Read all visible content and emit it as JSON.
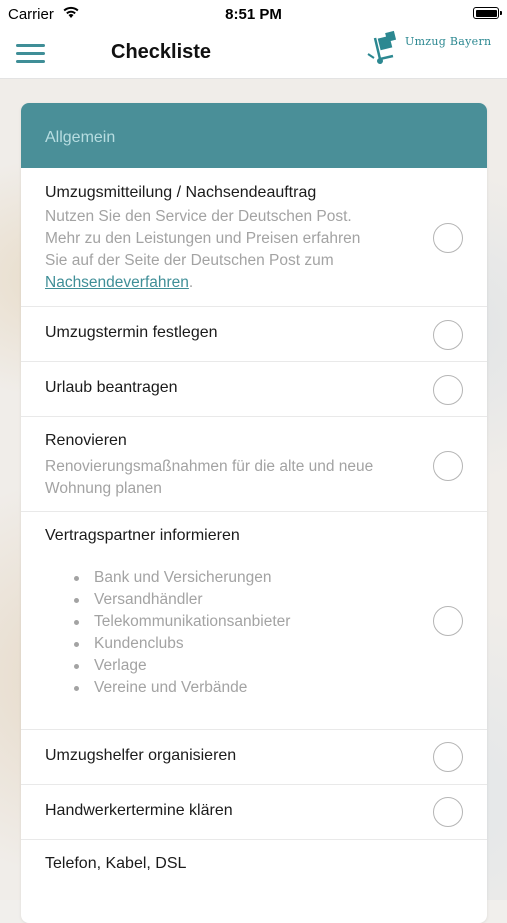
{
  "status": {
    "carrier": "Carrier",
    "time": "8:51 PM"
  },
  "header": {
    "title": "Checkliste",
    "logo_text": "Umzug Bayern"
  },
  "colors": {
    "accent": "#4a8f98",
    "link": "#3f8e97"
  },
  "section": {
    "title": "Allgemein"
  },
  "items": [
    {
      "title": "Umzugsmitteilung / Nachsendeauftrag",
      "desc_line1": "Nutzen Sie den Service der Deutschen Post.",
      "desc_line2": "Mehr zu den Leistungen und Preisen erfahren",
      "desc_line3": "Sie auf der Seite der Deutschen Post zum",
      "desc_link": "Nachsendeverfahren",
      "desc_end": "."
    },
    {
      "title": "Umzugstermin festlegen"
    },
    {
      "title": "Urlaub beantragen"
    },
    {
      "title": "Renovieren",
      "desc_line1": "Renovierungsmaßnahmen für die alte und neue",
      "desc_line2": "Wohnung planen"
    },
    {
      "title": "Vertragspartner informieren",
      "bullets": [
        "Bank und Versicherungen",
        "Versandhändler",
        "Telekommunikationsanbieter",
        "Kundenclubs",
        "Verlage",
        "Vereine und Verbände"
      ]
    },
    {
      "title": "Umzugshelfer organisieren"
    },
    {
      "title": "Handwerkertermine klären"
    },
    {
      "title": "Telefon, Kabel, DSL"
    }
  ]
}
